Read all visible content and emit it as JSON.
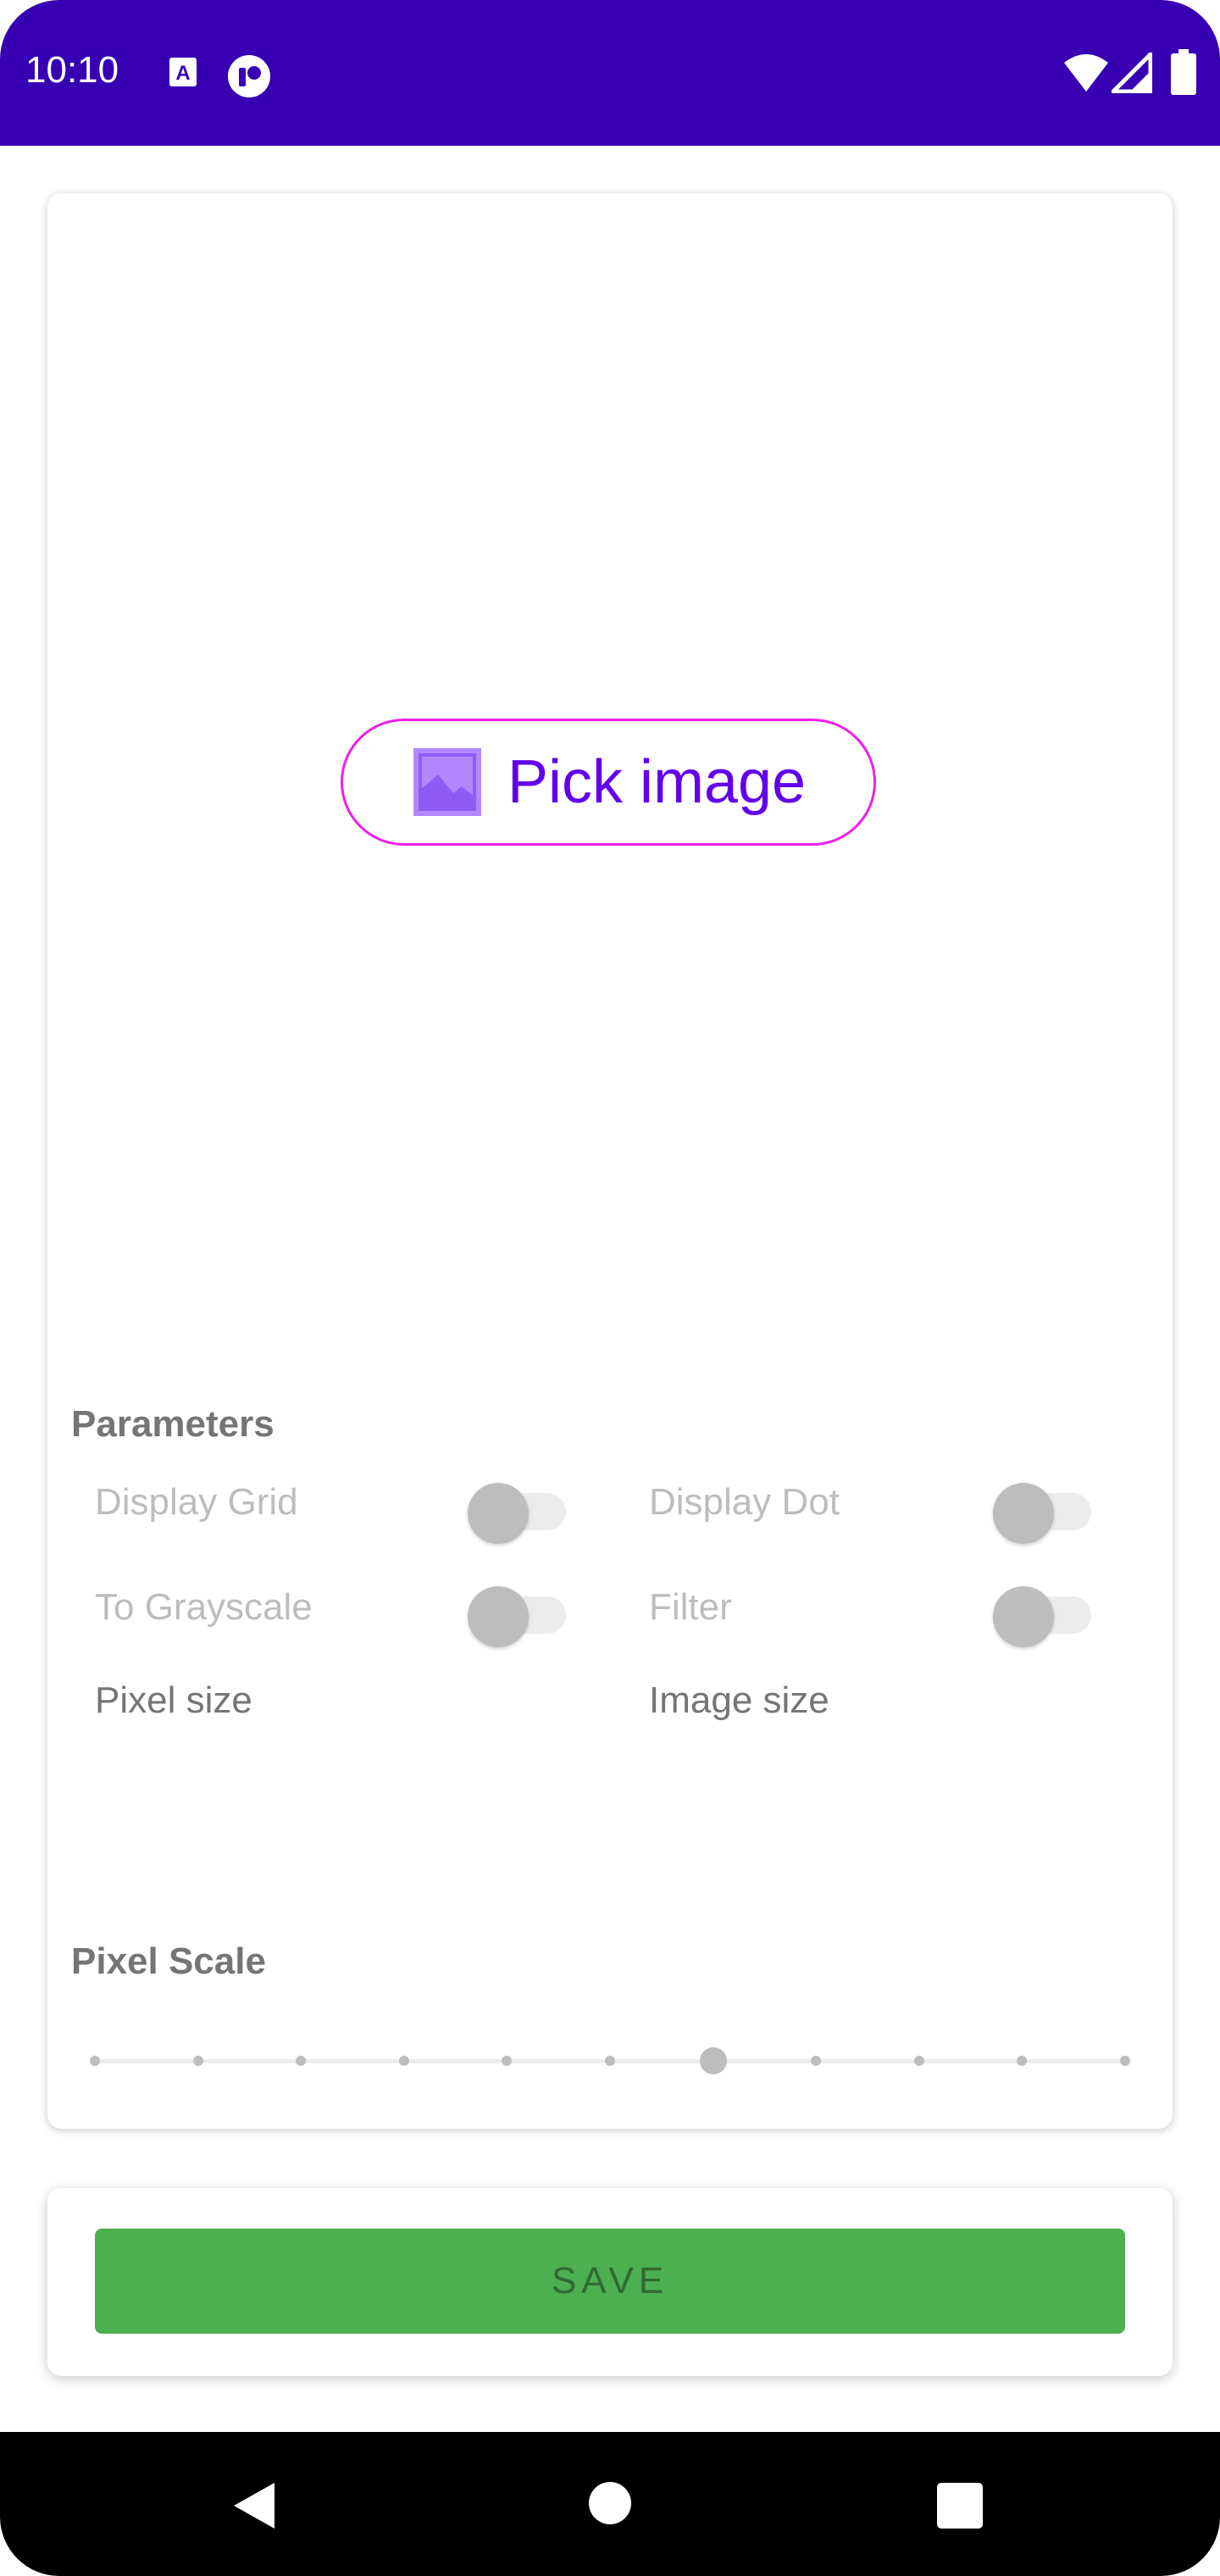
{
  "status_bar": {
    "time": "10:10",
    "left_icons": [
      "text-a-icon",
      "notification-icon"
    ],
    "right_icons": [
      "wifi-icon",
      "signal-icon",
      "battery-icon"
    ],
    "background": "#3700B3"
  },
  "image_area": {
    "pick_button": {
      "label": "Pick image",
      "icon": "image-icon",
      "border_color": "#EE1EE8",
      "text_color": "#6200EE"
    }
  },
  "parameters": {
    "title": "Parameters",
    "options": [
      {
        "label": "Display Grid",
        "enabled": false
      },
      {
        "label": "Display Dot",
        "enabled": false
      },
      {
        "label": "To Grayscale",
        "enabled": false
      },
      {
        "label": "Filter",
        "enabled": false
      }
    ],
    "pixel_size_label": "Pixel size",
    "image_size_label": "Image size"
  },
  "pixel_scale": {
    "title": "Pixel Scale",
    "steps": 11,
    "selected_index": 6
  },
  "save": {
    "label": "SAVE",
    "color": "#4CAF50"
  },
  "nav_bar": {
    "buttons": [
      "back-icon",
      "home-icon",
      "recents-icon"
    ]
  }
}
